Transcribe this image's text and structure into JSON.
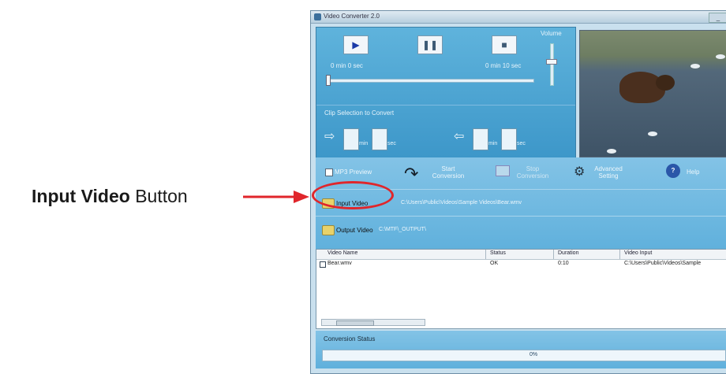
{
  "callout": {
    "bold": "Input Video",
    "rest": "Button",
    "color": "#e0262b"
  },
  "window": {
    "title": "Video Converter 2.0",
    "close": "_"
  },
  "player": {
    "play_icon": "▶",
    "pause_icon": "❚❚",
    "stop_icon": "■",
    "volume_label": "Volume",
    "time_left": "0 min 0 sec",
    "time_right": "0 min 10 sec",
    "segment_label": "Clip Selection to Convert",
    "start_arrow": "⇨",
    "end_arrow": "⇦",
    "min_unit": "min",
    "sec_unit": "sec"
  },
  "controls": {
    "mp3_preview": "MP3 Preview",
    "start_conversion": "Start Conversion",
    "stop_conversion": "Stop Conversion",
    "advanced_setting": "Advanced Setting",
    "help_icon": "?",
    "help": "Help",
    "input_video_label": "Input Video",
    "input_video_path": "C:\\Users\\Public\\Videos\\Sample Videos\\Bear.wmv",
    "output_video_label": "Output Video",
    "output_video_path": "C:\\MTF\\_OUTPUT\\"
  },
  "list": {
    "headers": [
      "Video Name",
      "Status",
      "Duration",
      "Video Input"
    ],
    "rows": [
      {
        "name": "Bear.wmv",
        "status": "OK",
        "duration": "0:10",
        "input": "C:\\Users\\Public\\Videos\\Sample"
      }
    ]
  },
  "status": {
    "label": "Conversion Status",
    "progress_text": "0%"
  }
}
